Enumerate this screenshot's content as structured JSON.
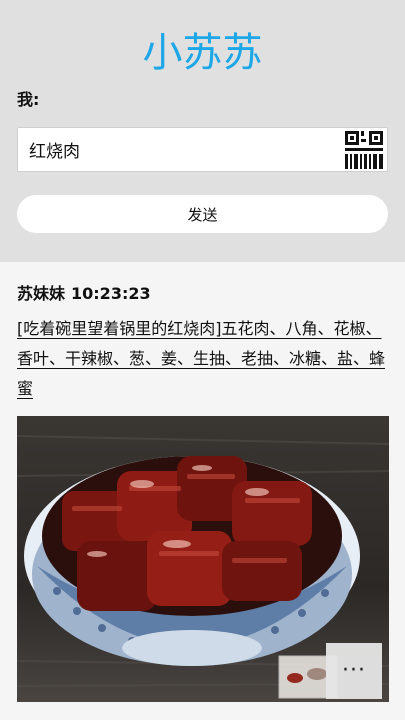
{
  "header": {
    "title": "小苏苏"
  },
  "composer": {
    "me_label": "我:",
    "input_value": "红烧肉",
    "send_label": "发送"
  },
  "reply": {
    "sender": "苏妹妹",
    "time": "10:23:23",
    "text": "[吃着碗里望着锅里的红烧肉]五花肉、八角、花椒、香叶、干辣椒、葱、姜、生抽、老抽、冰糖、盐、蜂蜜"
  },
  "more_button": {
    "label": "···"
  },
  "colors": {
    "title": "#1ea7e8",
    "top_panel": "#e0e0e0",
    "background": "#f5f5f5"
  },
  "icons": {
    "qr": "qr-code-icon",
    "more": "more-icon"
  }
}
